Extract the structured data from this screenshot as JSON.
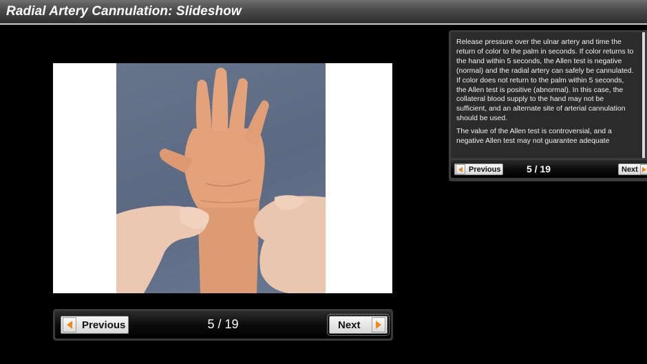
{
  "header": {
    "title": "Radial Artery Cannulation: Slideshow"
  },
  "slide": {
    "image_subject": "hand-wrist-allen-test-photo",
    "background_color": "#ffffff"
  },
  "main_nav": {
    "previous_label": "Previous",
    "counter": "5 / 19",
    "next_label": "Next",
    "current": 5,
    "total": 19
  },
  "side_panel": {
    "paragraphs": [
      "Release pressure over the ulnar artery and time the return of color to the palm in seconds. If color returns to the hand within 5 seconds, the Allen test is negative (normal) and the radial artery can safely be cannulated. If color does not return to the palm within 5 seconds, the Allen test is positive (abnormal). In this case, the collateral blood supply to the hand may not be sufficient, and an alternate site of arterial cannulation should be used.",
      "The value of the Allen test is controversial, and a negative Allen test may not guarantee adequate"
    ],
    "nav": {
      "previous_label": "Previous",
      "counter": "5 / 19",
      "next_label": "Next"
    }
  },
  "colors": {
    "accent_arrow": "#f08a1c",
    "background": "#000000",
    "photo_backdrop": "#5f6d86",
    "skin": "#e3a27a"
  }
}
